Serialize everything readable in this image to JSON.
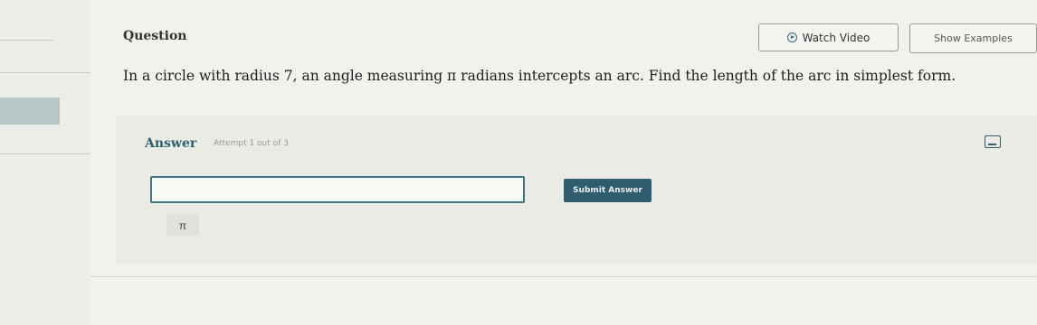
{
  "question": {
    "label": "Question",
    "text": "In a circle with radius 7, an angle measuring π radians intercepts an arc. Find the length of the arc in simplest form."
  },
  "toolbar": {
    "watch_video_label": "Watch Video",
    "show_examples_label": "Show Examples"
  },
  "answer": {
    "label": "Answer",
    "attempt_text": "Attempt 1 out of 3",
    "input_value": "",
    "submit_label": "Submit Answer",
    "pi_button_label": "π"
  },
  "icons": {
    "video": "play-circle-icon",
    "keyboard": "keyboard-icon"
  },
  "colors": {
    "accent": "#2f5d6e",
    "background": "#f1f1ed"
  }
}
